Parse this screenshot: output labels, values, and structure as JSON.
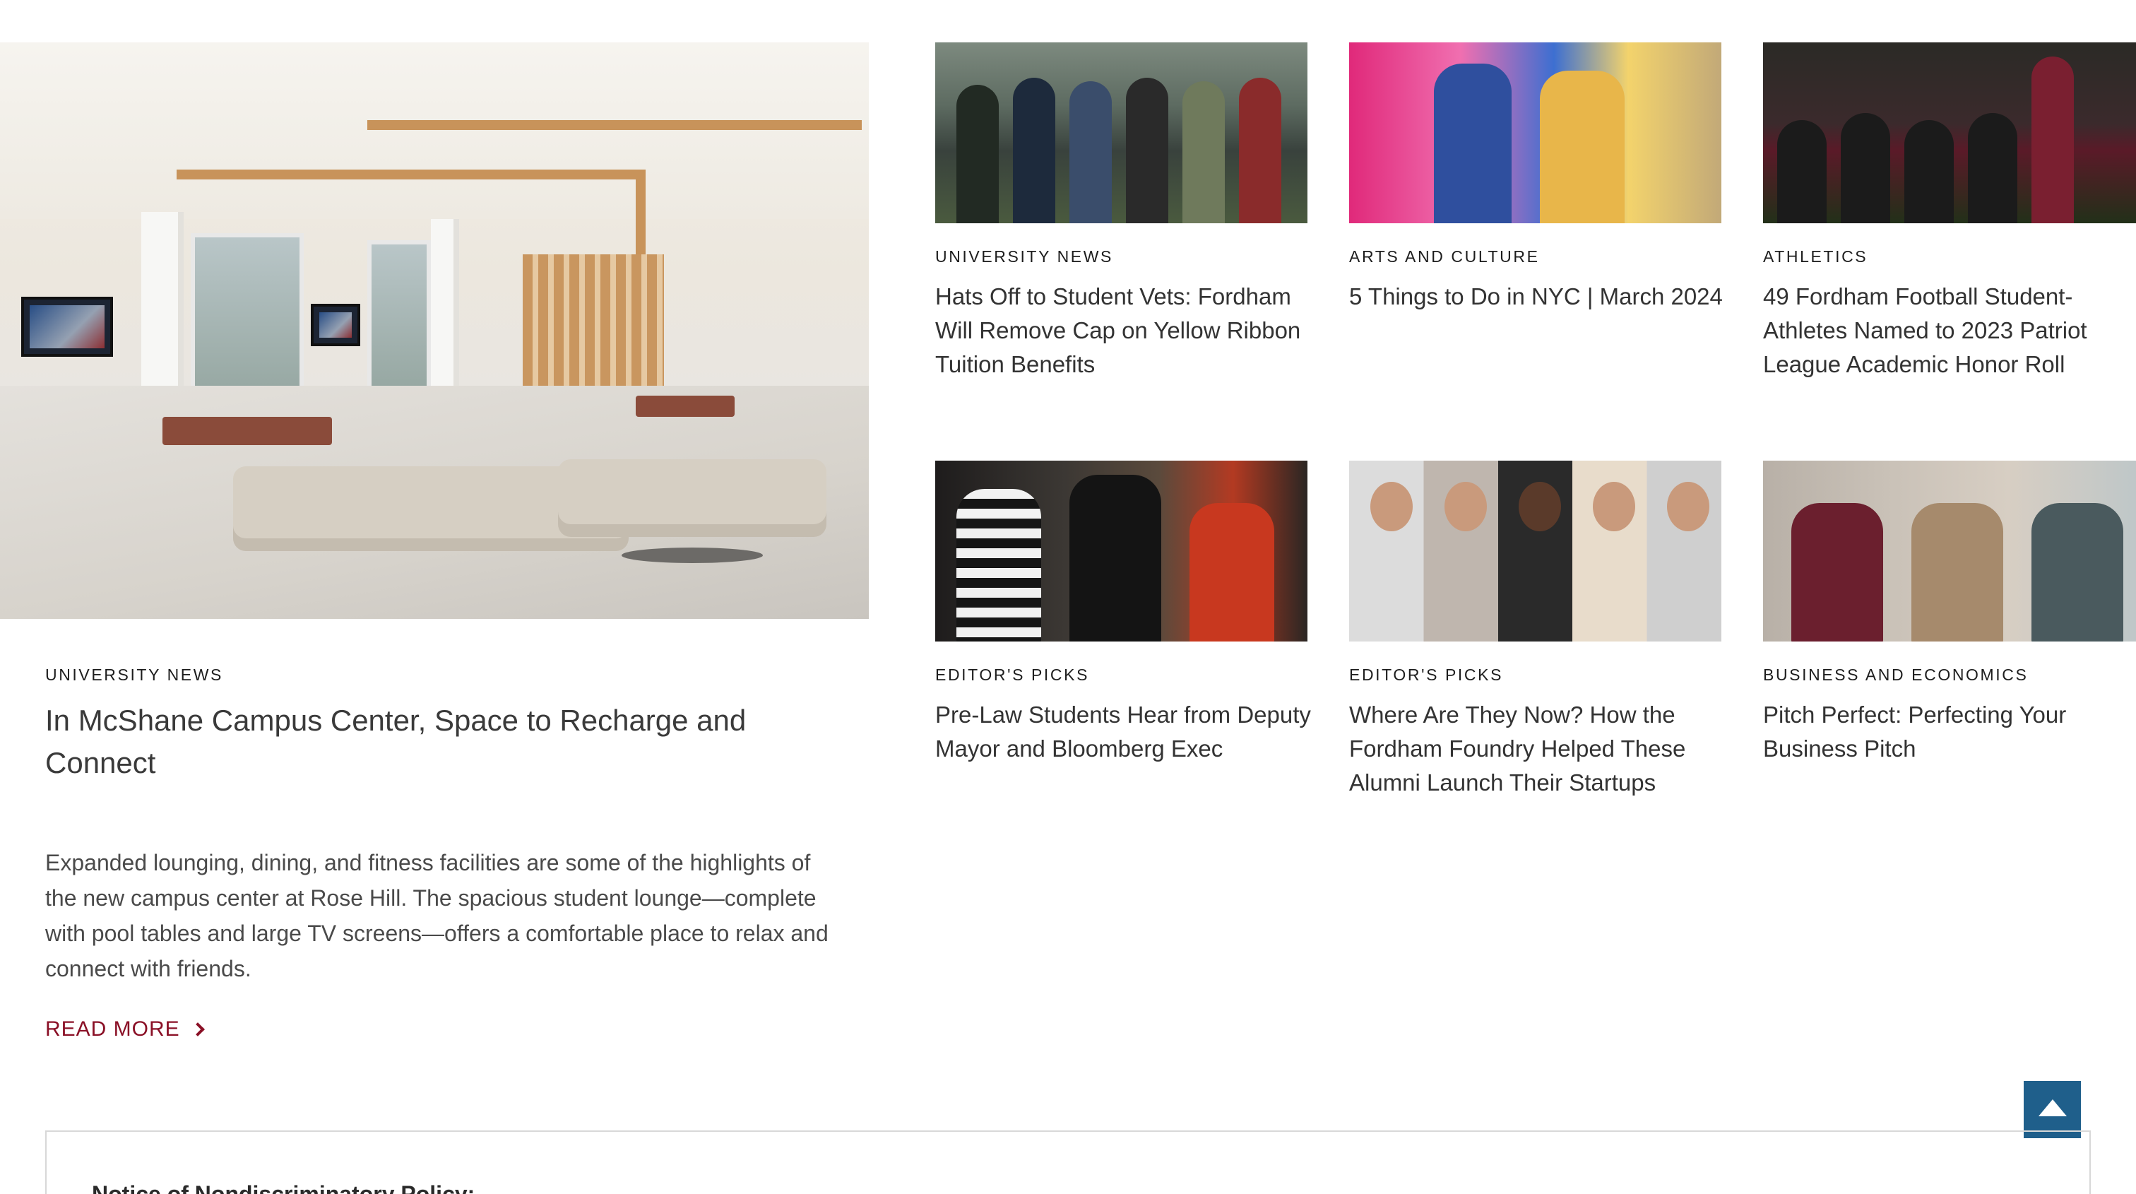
{
  "featured": {
    "category": "UNIVERSITY NEWS",
    "title": "In McShane Campus Center, Space to Recharge and Connect",
    "summary": "Expanded lounging, dining, and fitness facilities are some of the highlights of the new campus center at Rose Hill. The spacious student lounge—complete with pool tables and large TV screens—offers a comfortable place to relax and connect with friends.",
    "read_more": "READ MORE"
  },
  "stories": [
    {
      "category": "UNIVERSITY NEWS",
      "title": "Hats Off to Student Vets: Fordham Will Remove Cap on Yellow Ribbon Tuition Benefits"
    },
    {
      "category": "ARTS AND CULTURE",
      "title": "5 Things to Do in NYC | March 2024"
    },
    {
      "category": "ATHLETICS",
      "title": "49 Fordham Football Student-Athletes Named to 2023 Patriot League Academic Honor Roll"
    },
    {
      "category": "EDITOR'S PICKS",
      "title": "Pre-Law Students Hear from Deputy Mayor and Bloomberg Exec"
    },
    {
      "category": "EDITOR'S PICKS",
      "title": "Where Are They Now? How the Fordham Foundry Helped These Alumni Launch Their Startups"
    },
    {
      "category": "BUSINESS AND ECONOMICS",
      "title": "Pitch Perfect: Perfecting Your Business Pitch"
    }
  ],
  "notice": {
    "title": "Notice of Nondiscriminatory Policy:"
  },
  "icons": {
    "read_more": "chevron-right-icon",
    "back_to_top": "arrow-up-icon"
  },
  "colors": {
    "accent": "#8a1026",
    "back_to_top": "#1f5f8b",
    "border": "#d8d8d8"
  }
}
